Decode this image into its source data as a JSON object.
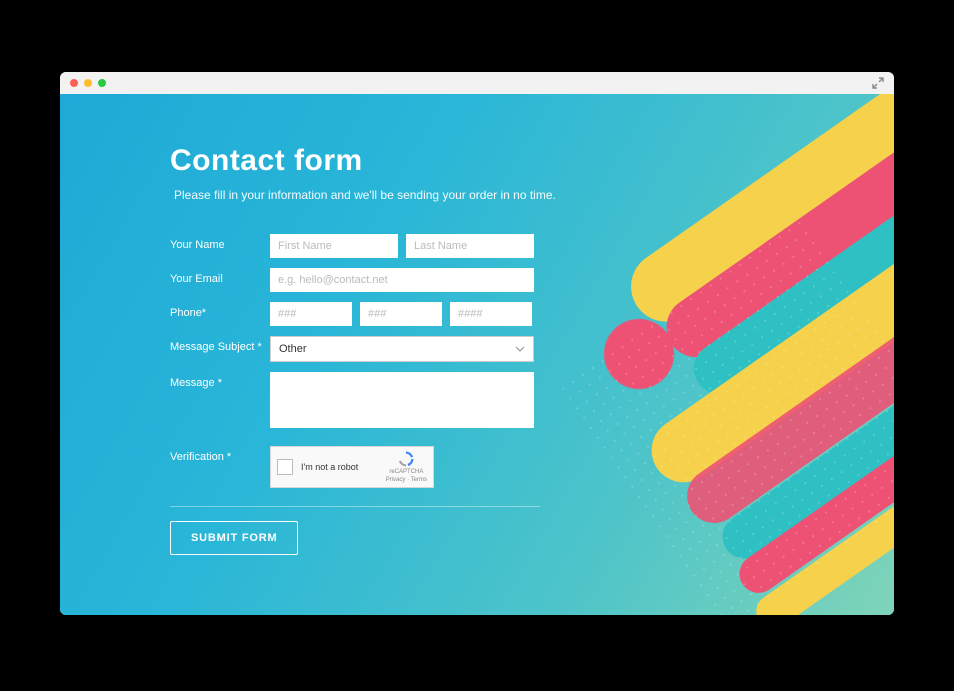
{
  "header": {
    "title": "Contact form",
    "subtitle": "Please fill in your information and we'll be sending your order in no time."
  },
  "form": {
    "name": {
      "label": "Your Name",
      "first_placeholder": "First Name",
      "last_placeholder": "Last Name"
    },
    "email": {
      "label": "Your Email",
      "placeholder": "e.g. hello@contact.net"
    },
    "phone": {
      "label": "Phone*",
      "p1": "###",
      "p2": "###",
      "p3": "####"
    },
    "subject": {
      "label": "Message Subject *",
      "selected": "Other"
    },
    "message": {
      "label": "Message *"
    },
    "verification": {
      "label": "Verification *",
      "captcha_text": "I'm not a robot",
      "captcha_brand": "reCAPTCHA",
      "captcha_terms": "Privacy · Terms"
    },
    "submit": "SUBMIT FORM"
  }
}
